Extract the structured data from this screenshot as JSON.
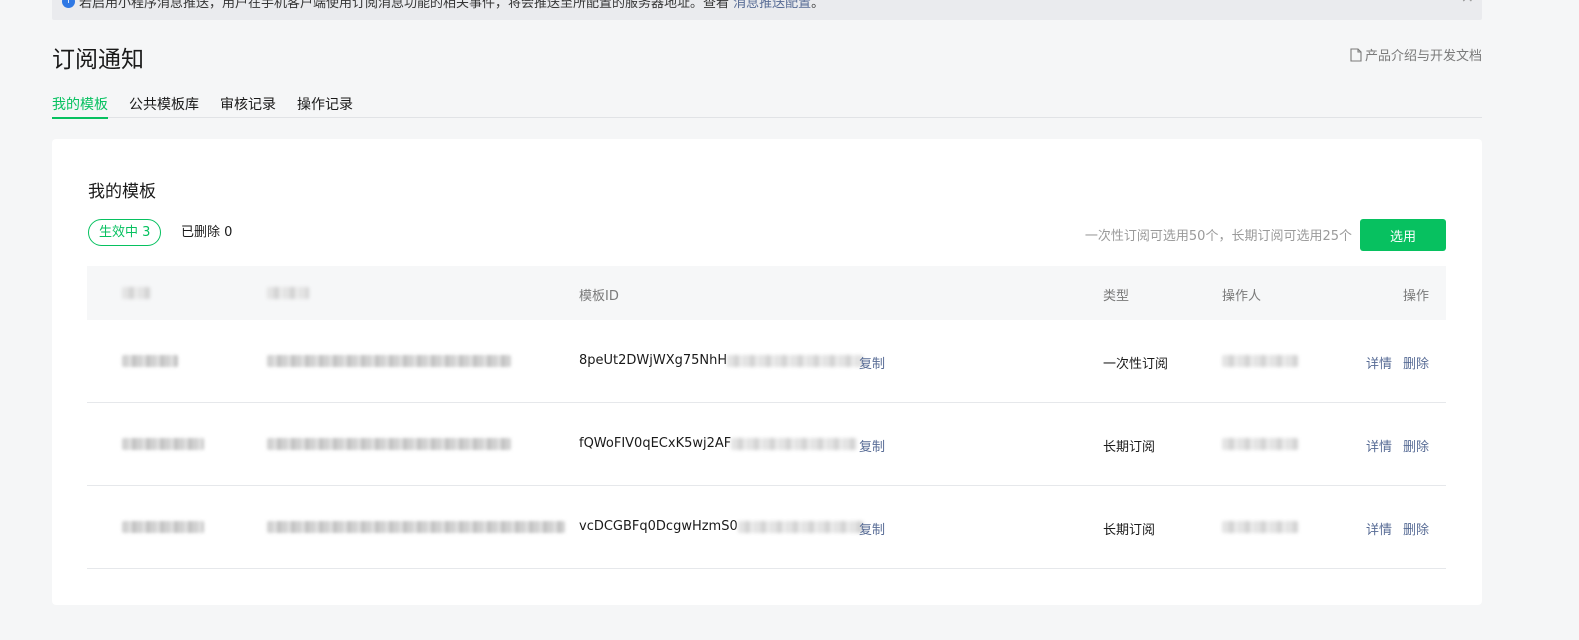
{
  "notice": {
    "text": "若启用小程序消息推送，用户在手机客户端使用订阅消息功能的相关事件，将会推送至所配置的服务器地址。查看",
    "link": "消息推送配置",
    "suffix": "。",
    "close": "×"
  },
  "page": {
    "title": "订阅通知",
    "doc_link": "产品介绍与开发文档"
  },
  "tabs": [
    {
      "label": "我的模板",
      "active": true
    },
    {
      "label": "公共模板库",
      "active": false
    },
    {
      "label": "审核记录",
      "active": false
    },
    {
      "label": "操作记录",
      "active": false
    }
  ],
  "card": {
    "title": "我的模板",
    "filter_active": "生效中  3",
    "filter_deleted": "已删除  0",
    "quota_hint": "一次性订阅可选用50个，长期订阅可选用25个",
    "select_button": "选用"
  },
  "table": {
    "headers": {
      "template_id": "模板ID",
      "type": "类型",
      "operator": "操作人",
      "actions": "操作"
    },
    "rows": [
      {
        "id_prefix": "8peUt2DWjWXg75NhH",
        "copy": "复制",
        "type": "一次性订阅",
        "detail": "详情",
        "delete": "删除"
      },
      {
        "id_prefix": "fQWoFIV0qECxK5wj2AF",
        "copy": "复制",
        "type": "长期订阅",
        "detail": "详情",
        "delete": "删除"
      },
      {
        "id_prefix": "vcDCGBFq0DcgwHzmS0",
        "copy": "复制",
        "type": "长期订阅",
        "detail": "详情",
        "delete": "删除"
      }
    ]
  },
  "colors": {
    "accent": "#07c160",
    "link": "#576b95"
  }
}
